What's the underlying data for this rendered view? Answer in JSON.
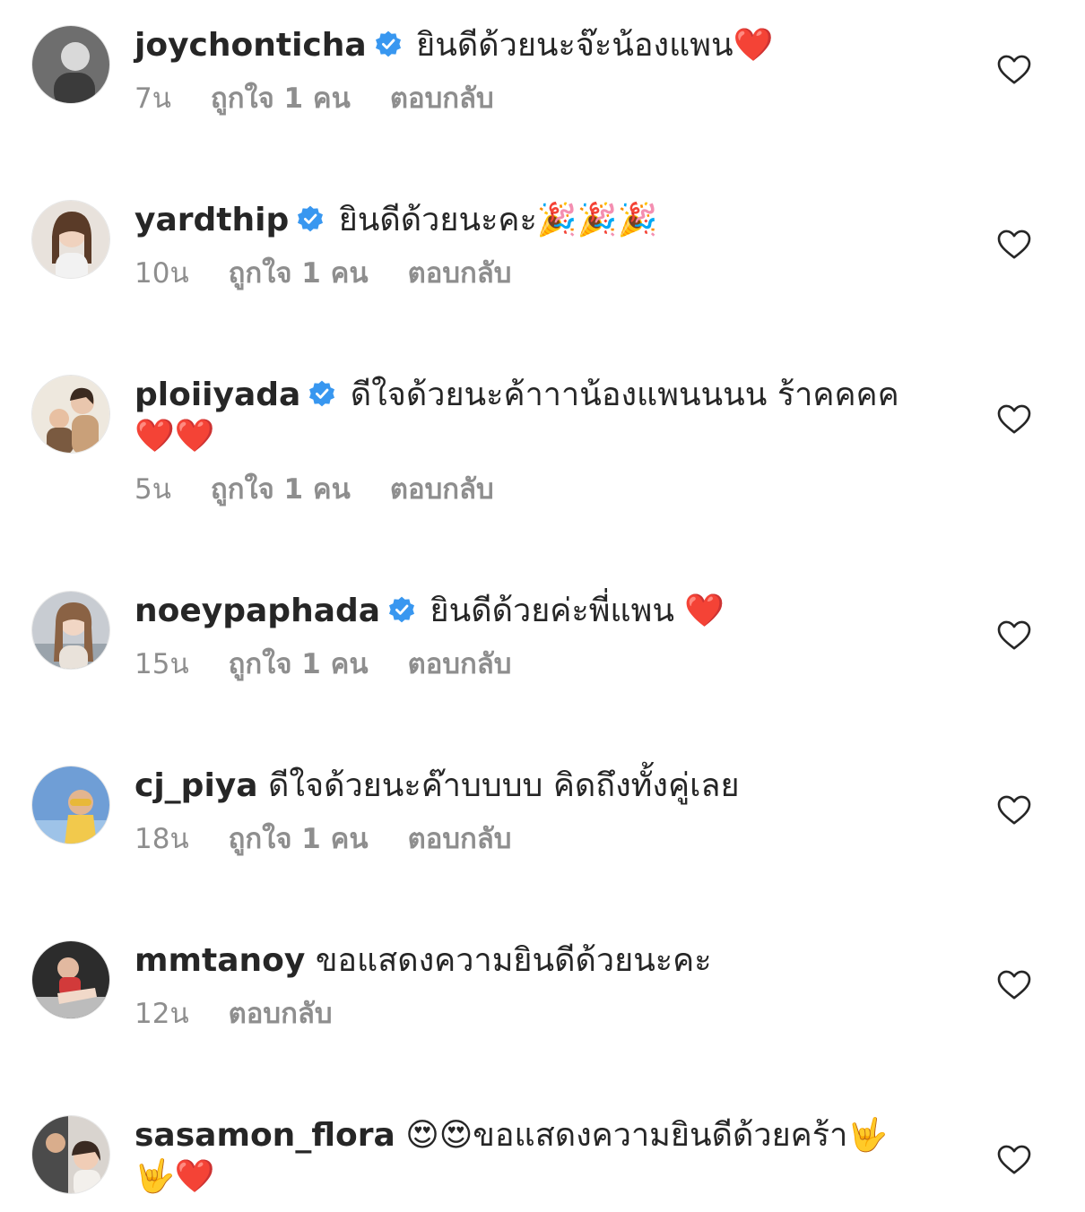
{
  "colors": {
    "text": "#262626",
    "meta": "#8e8e8e",
    "verified": "#3897f0",
    "heart_emoji": "#e0242f",
    "like_outline": "#262626"
  },
  "comments": [
    {
      "username": "joychonticha",
      "verified": true,
      "text": "ยินดีด้วยนะจ๊ะน้องแพน❤️",
      "line2": "",
      "time": "7น",
      "likes": "ถูกใจ 1 คน",
      "reply": "ตอบกลับ",
      "like_icon": "heart-outline-icon"
    },
    {
      "username": "yardthip",
      "verified": true,
      "text": "ยินดีด้วยนะคะ🎉🎉🎉",
      "line2": "",
      "time": "10น",
      "likes": "ถูกใจ 1 คน",
      "reply": "ตอบกลับ",
      "like_icon": "heart-outline-icon"
    },
    {
      "username": "ploiiyada",
      "verified": true,
      "text": "ดีใจด้วยนะค้าาาน้องแพนนนน ร้าคคคค",
      "line2": "❤️❤️",
      "time": "5น",
      "likes": "ถูกใจ 1 คน",
      "reply": "ตอบกลับ",
      "like_icon": "heart-outline-icon"
    },
    {
      "username": "noeypaphada",
      "verified": true,
      "text": "ยินดีด้วยค่ะพี่แพน ❤️",
      "line2": "",
      "time": "15น",
      "likes": "ถูกใจ 1 คน",
      "reply": "ตอบกลับ",
      "like_icon": "heart-outline-icon"
    },
    {
      "username": "cj_piya",
      "verified": false,
      "text": "ดีใจด้วยนะค๊าบบบบ คิดถึงทั้งคู่เลย",
      "line2": "",
      "time": "18น",
      "likes": "ถูกใจ 1 คน",
      "reply": "ตอบกลับ",
      "like_icon": "heart-outline-icon"
    },
    {
      "username": "mmtanoy",
      "verified": false,
      "text": "ขอแสดงความยินดีด้วยนะคะ",
      "line2": "",
      "time": "12น",
      "likes": "",
      "reply": "ตอบกลับ",
      "like_icon": "heart-outline-icon"
    },
    {
      "username": "sasamon_flora",
      "verified": false,
      "text": "😍😍ขอแสดงความยินดีด้วยคร้า🤟",
      "line2": "🤟❤️",
      "time": "",
      "likes": "",
      "reply": "",
      "like_icon": "heart-outline-icon"
    }
  ]
}
